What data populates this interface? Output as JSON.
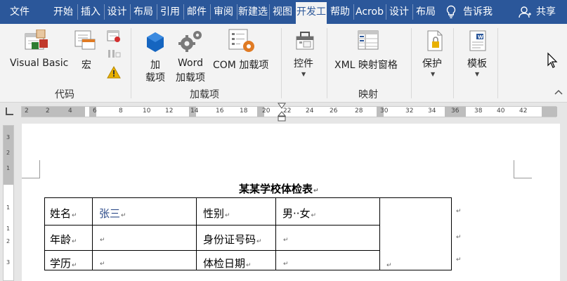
{
  "tabs": [
    {
      "label": "文件",
      "active": false
    },
    {
      "label": "开始",
      "active": false
    },
    {
      "label": "插入",
      "active": false
    },
    {
      "label": "设计",
      "active": false
    },
    {
      "label": "布局",
      "active": false
    },
    {
      "label": "引用",
      "active": false
    },
    {
      "label": "邮件",
      "active": false
    },
    {
      "label": "审阅",
      "active": false
    },
    {
      "label": "新建选",
      "active": false
    },
    {
      "label": "视图",
      "active": false
    },
    {
      "label": "开发工",
      "active": true
    },
    {
      "label": "帮助",
      "active": false
    },
    {
      "label": "Acrob",
      "active": false
    },
    {
      "label": "设计",
      "active": false
    },
    {
      "label": "布局",
      "active": false
    }
  ],
  "tell_me": "告诉我",
  "share": "共享",
  "ribbon": {
    "visual_basic": "Visual Basic",
    "macro": "宏",
    "group_code": "代码",
    "addins_line1": "加",
    "addins_line2": "载项",
    "word_addins_line1": "Word",
    "word_addins_line2": "加载项",
    "com_addins": "COM 加载项",
    "group_addins": "加载项",
    "controls": "控件",
    "xml_pane": "XML 映射窗格",
    "group_mapping": "映射",
    "protect": "保护",
    "templates": "模板"
  },
  "ruler": {
    "numbers": [
      "2",
      "2",
      "4",
      "6",
      "8",
      "10",
      "12",
      "14",
      "16",
      "18",
      "20",
      "22",
      "24",
      "26",
      "28",
      "30",
      "32",
      "34",
      "36",
      "38",
      "40",
      "42"
    ],
    "vertical_numbers": [
      "3",
      "2",
      "1",
      "1",
      "1",
      "2",
      "3"
    ]
  },
  "document": {
    "title": "某某学校体检表",
    "rows": [
      [
        {
          "text": "姓名",
          "color": "#000000"
        },
        {
          "text": "张三",
          "color": "#2e4c8a"
        },
        {
          "text": "性别",
          "color": "#000000"
        },
        {
          "text": "男··女",
          "color": "#000000"
        },
        {
          "text": "",
          "color": "#000000"
        }
      ],
      [
        {
          "text": "年龄",
          "color": "#000000"
        },
        {
          "text": "",
          "color": "#000000"
        },
        {
          "text": "身份证号码",
          "color": "#000000"
        },
        {
          "text": "",
          "color": "#000000"
        },
        {
          "text": "",
          "color": "#000000"
        }
      ],
      [
        {
          "text": "学历",
          "color": "#000000"
        },
        {
          "text": "",
          "color": "#000000"
        },
        {
          "text": "体检日期",
          "color": "#000000"
        },
        {
          "text": "",
          "color": "#000000"
        },
        {
          "text": "",
          "color": "#000000"
        }
      ]
    ]
  },
  "colors": {
    "title_bar": "#2b579a",
    "ribbon_bg": "#f3f3f3",
    "icon_blue": "#1565c0",
    "icon_gray": "#7a7a7a",
    "warning": "#e8b000"
  },
  "icons": [
    "visual-basic-icon",
    "macro-icon",
    "record-macro-icon",
    "pause-recording-icon",
    "macro-security-icon",
    "addins-icon",
    "word-addins-icon",
    "com-addins-icon",
    "controls-icon",
    "xml-mapping-icon",
    "protect-icon",
    "templates-icon",
    "lightbulb-icon",
    "user-icon",
    "cursor-icon",
    "collapse-ribbon-icon"
  ]
}
